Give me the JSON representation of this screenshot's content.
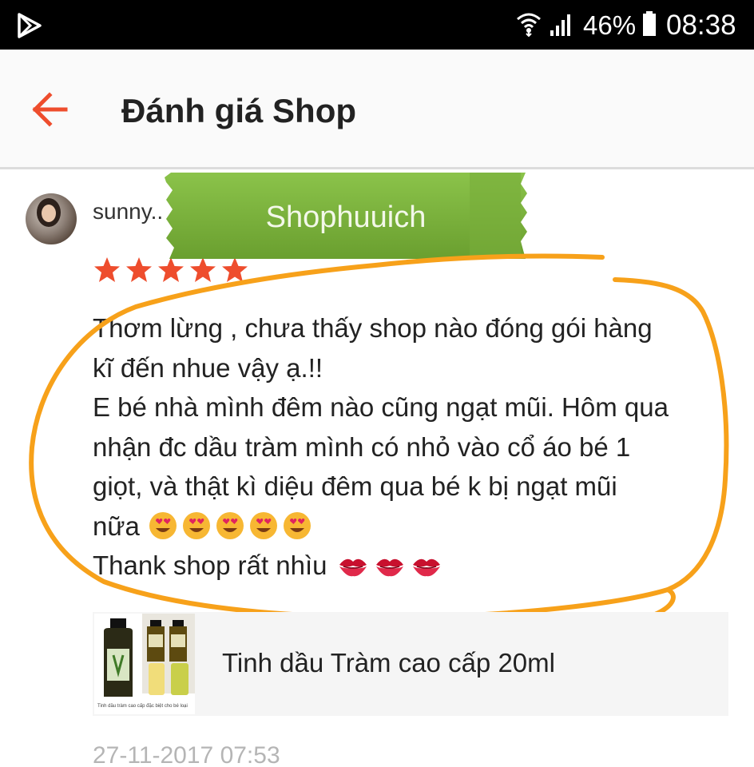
{
  "status_bar": {
    "battery_percent": "46%",
    "time": "08:38",
    "icons": [
      "play-store-icon",
      "wifi-icon",
      "signal-icon",
      "battery-icon"
    ]
  },
  "header": {
    "title": "Đánh giá Shop",
    "back_icon": "arrow-left-icon"
  },
  "review": {
    "username": "sunny..",
    "rating": 5,
    "rating_max": 5,
    "comment_lines": [
      "Thơm lừng , chưa thấy shop nào đóng gói hàng",
      "kĩ đến nhue vậy ạ.!!",
      "E bé nhà mình đêm nào cũng ngạt mũi. Hôm qua",
      "nhận đc dầu tràm mình có nhỏ vào cổ áo bé 1",
      "giọt, và thật kì diệu đêm qua bé k bị ngạt mũi",
      "nữa",
      "Thank shop rất nhìu"
    ],
    "emoji_heart_eyes_count": 5,
    "emoji_kiss_count": 3,
    "product": {
      "name": "Tinh dầu Tràm cao cấp 20ml",
      "image_caption": "Tinh dầu tràm cao cấp đặc biệt cho bé loại"
    },
    "timestamp": "27-11-2017 07:53"
  },
  "watermark": {
    "text": "Shophuuich"
  },
  "colors": {
    "accent": "#ee4d2d",
    "star": "#ee4d2d",
    "watermark_green": "#7cb342",
    "annotation_orange": "#f7a11a"
  }
}
